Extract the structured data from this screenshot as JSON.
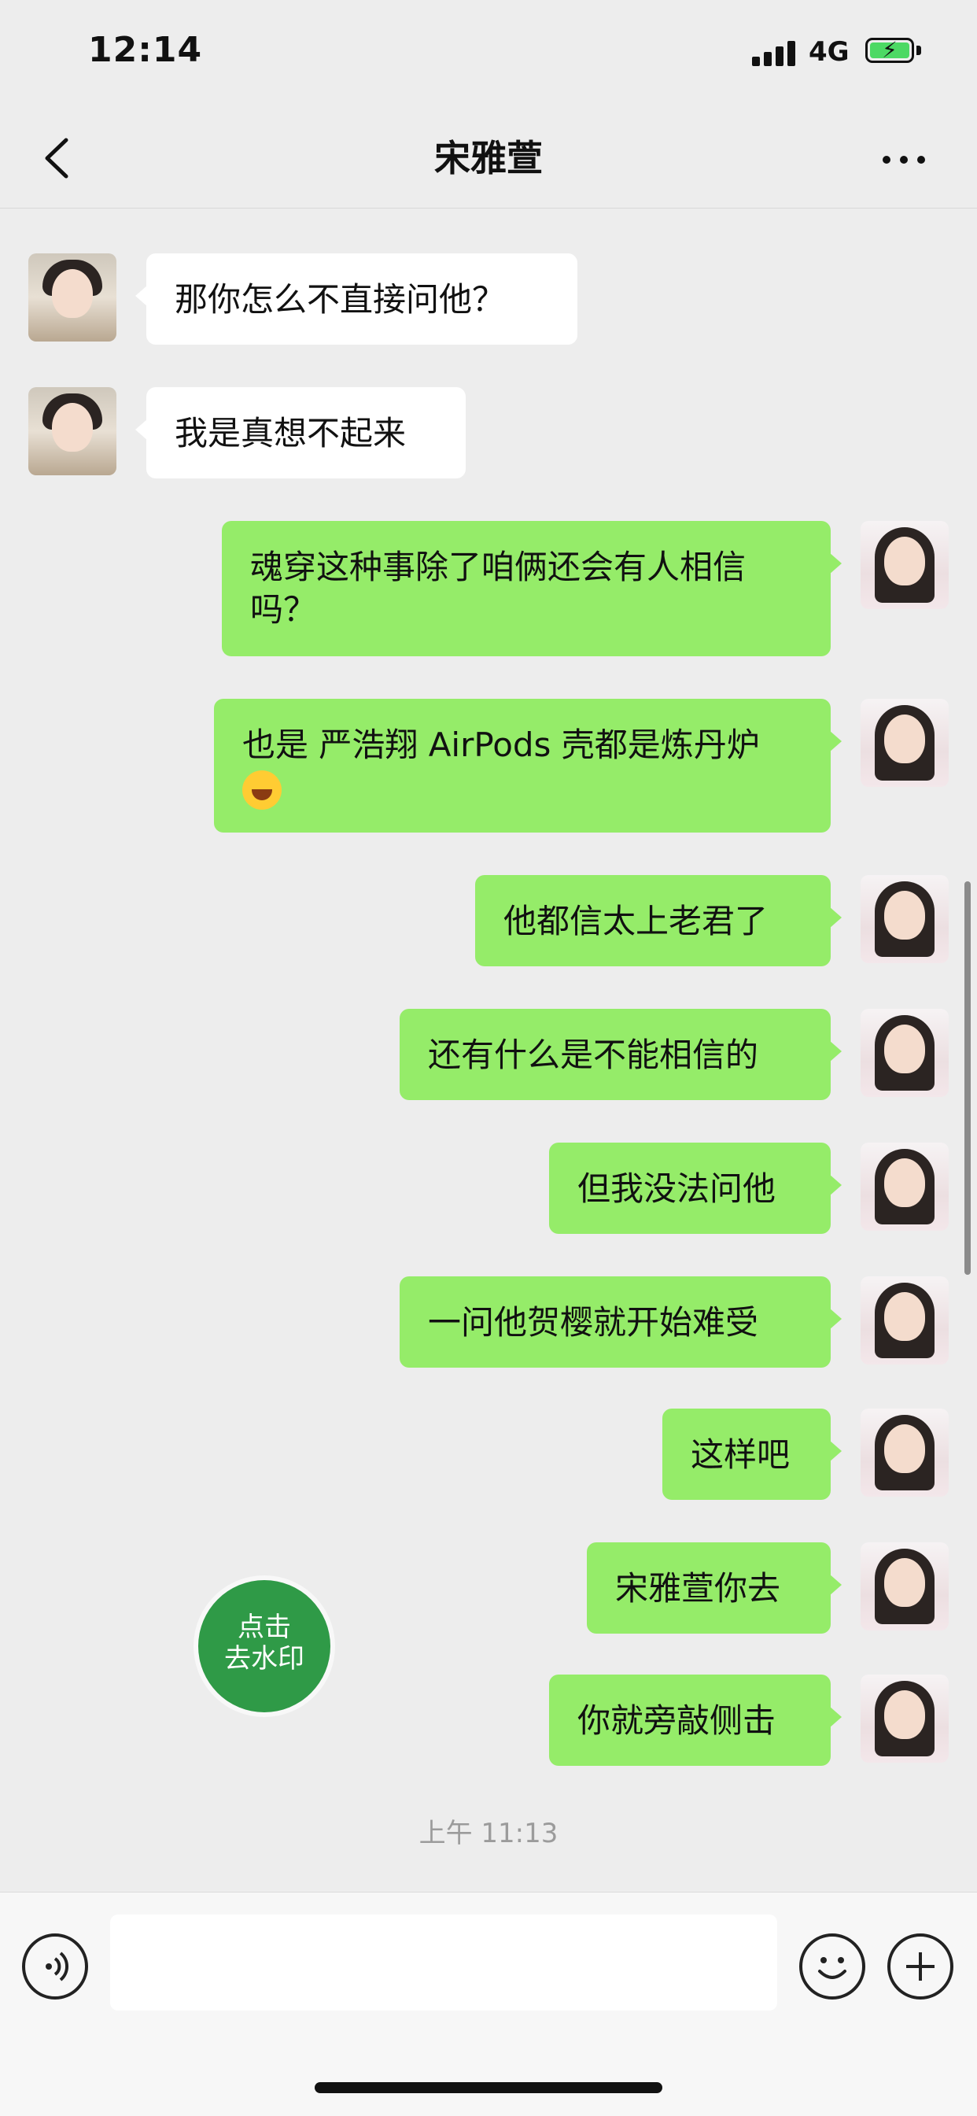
{
  "status_bar": {
    "time": "12:14",
    "network": "4G"
  },
  "nav": {
    "title": "宋雅萱"
  },
  "messages": [
    {
      "side": "in",
      "text": "那你怎么不直接问他？"
    },
    {
      "side": "in",
      "text": "我是真想不起来"
    },
    {
      "side": "out",
      "text": "魂穿这种事除了咱俩还会有人相信\n吗？"
    },
    {
      "side": "out",
      "text": "也是 严浩翔 AirPods 壳都是炼丹炉",
      "emoji": "sweat-smile-emoji"
    },
    {
      "side": "out",
      "text": "他都信太上老君了"
    },
    {
      "side": "out",
      "text": "还有什么是不能相信的"
    },
    {
      "side": "out",
      "text": "但我没法问他"
    },
    {
      "side": "out",
      "text": "一问他贺樱就开始难受"
    },
    {
      "side": "out",
      "text": "这样吧"
    },
    {
      "side": "out",
      "text": "宋雅萱你去"
    },
    {
      "side": "out",
      "text": "你就旁敲侧击"
    }
  ],
  "timestamp": "上午 11:13",
  "watermark_button": {
    "line1": "点击",
    "line2": "去水印"
  },
  "input_bar": {
    "placeholder": ""
  },
  "colors": {
    "bubble_out": "#95ec69",
    "bubble_in": "#ffffff",
    "background": "#ededed",
    "watermark_btn": "#2f9a47"
  }
}
